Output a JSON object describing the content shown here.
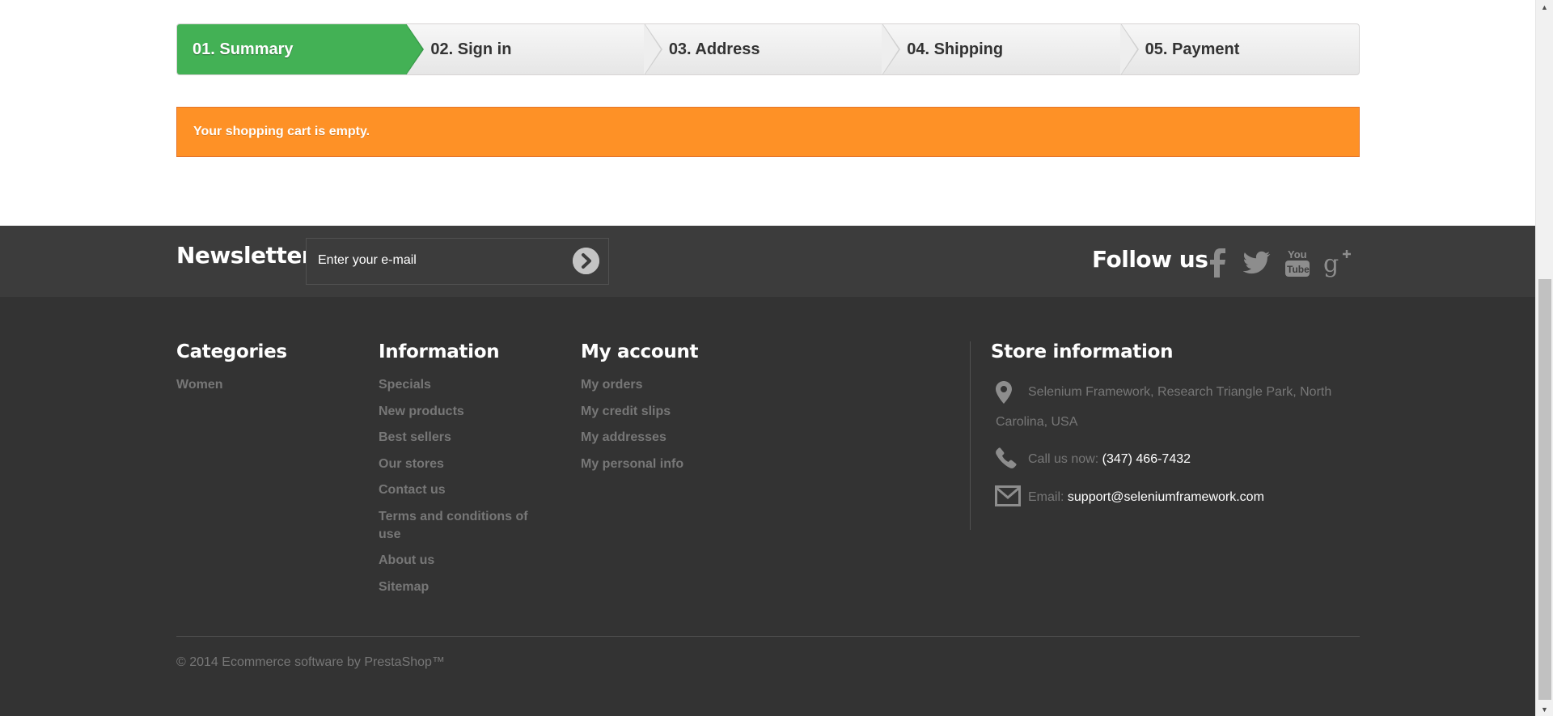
{
  "steps": [
    {
      "label": "01. Summary",
      "active": true
    },
    {
      "label": "02. Sign in",
      "active": false
    },
    {
      "label": "03. Address",
      "active": false
    },
    {
      "label": "04. Shipping",
      "active": false
    },
    {
      "label": "05. Payment",
      "active": false
    }
  ],
  "alert": {
    "text": "Your shopping cart is empty."
  },
  "newsletter": {
    "title": "Newsletter",
    "placeholder": "Enter your e-mail"
  },
  "follow": {
    "title": "Follow us",
    "icons": [
      "facebook-icon",
      "twitter-icon",
      "youtube-icon",
      "google-plus-icon"
    ]
  },
  "categories": {
    "title": "Categories",
    "items": [
      "Women"
    ]
  },
  "information": {
    "title": "Information",
    "items": [
      "Specials",
      "New products",
      "Best sellers",
      "Our stores",
      "Contact us",
      "Terms and conditions of use",
      "About us",
      "Sitemap"
    ]
  },
  "account": {
    "title": "My account",
    "items": [
      "My orders",
      "My credit slips",
      "My addresses",
      "My personal info"
    ]
  },
  "store": {
    "title": "Store information",
    "address_line1": "Selenium Framework, Research Triangle Park, North",
    "address_line2": "Carolina, USA",
    "call_label": "Call us now:",
    "phone": "(347) 466-7432",
    "email_label": "Email:",
    "email": "support@seleniumframework.com"
  },
  "copyright": "© 2014 Ecommerce software by PrestaShop™",
  "colors": {
    "step_active": "#43b155",
    "alert": "#fe9126",
    "footer": "#333333",
    "footer_top": "#3c3c3c"
  }
}
